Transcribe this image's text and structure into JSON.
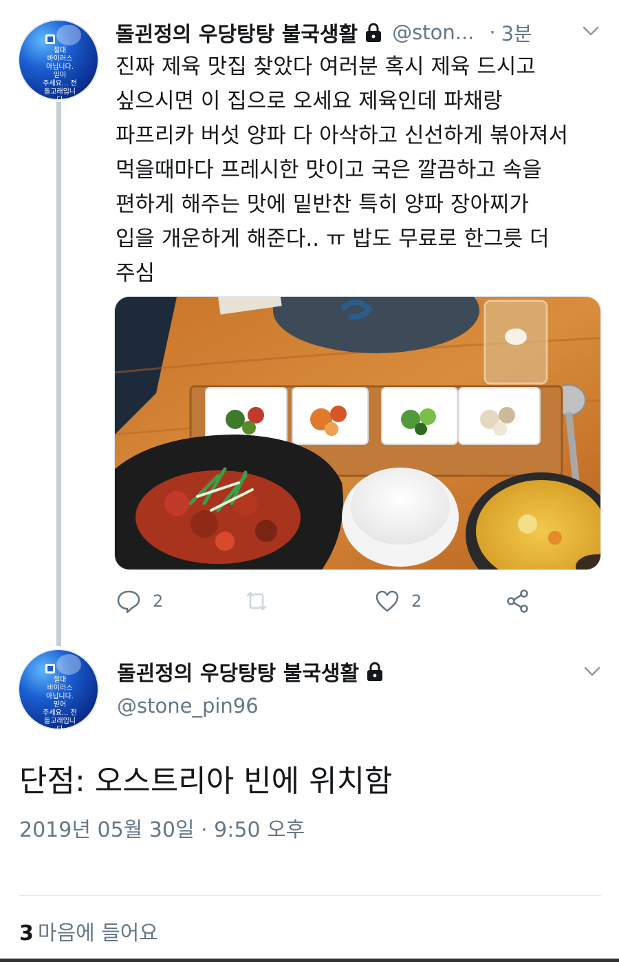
{
  "tweet": {
    "author_name": "돌괸정의 우당탕탕 불국생활",
    "handle": "@ston...",
    "separator": "·",
    "time": "3분",
    "avatar_text": "절대\n바이러스\n아닙니다.\n믿어\n주세요... 전\n돌고래입니\n다",
    "text_lines": [
      "진짜 제육 맛집 찾았다 여러분 혹시 제육 드시고",
      "싶으시면 이 집으로 오세요 제육인데 파채랑",
      "파프리카 버섯 양파 다 아삭하고 신선하게 볶아져서",
      "먹을때마다 프레시한 맛이고 국은 깔끔하고 속을",
      "편하게 해주는 맛에 밑반찬 특히 양파 장아찌가",
      "입을 개운하게 해준다.. ㅠ 밥도 무료로 한그릇 더",
      "주심"
    ],
    "actions": {
      "reply_count": "2",
      "retweet_count": "",
      "like_count": "2"
    }
  },
  "reply": {
    "author_name": "돌괸정의 우당탕탕 불국생활",
    "handle": "@stone_pin96",
    "avatar_text": "절대\n바이러스\n아닙니다.\n믿어\n주세요... 전\n돌고래입니\n다",
    "text": "단점: 오스트리아 빈에 위치함",
    "timestamp": "2019년 05월 30일 · 9:50 오후",
    "likes_count": "3",
    "likes_label": "마음에 들어요"
  },
  "colors": {
    "text": "#14171a",
    "secondary": "#657786",
    "thread_line": "#c4cfd6",
    "divider": "#e1e8ed"
  },
  "icons": [
    "lock-icon",
    "chevron-down-icon",
    "reply-icon",
    "retweet-icon",
    "like-icon",
    "share-icon"
  ]
}
